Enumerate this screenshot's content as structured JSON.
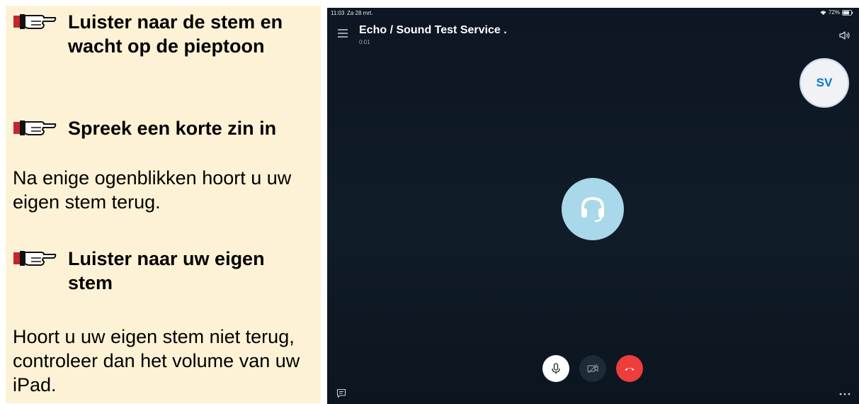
{
  "instructions": {
    "step1": "Luister naar de stem en wacht op de pieptoon",
    "step2": "Spreek een korte zin in",
    "para1": "Na enige ogenblikken hoort u uw eigen stem terug.",
    "step3": "Luister naar uw eigen stem",
    "para2": "Hoort u uw eigen stem niet terug, controleer dan het volume van uw iPad."
  },
  "status_bar": {
    "time": "11:03",
    "date": "Za 28 mrt.",
    "battery": "72%"
  },
  "call": {
    "title": "Echo / Sound Test Service .",
    "duration": "0:01",
    "participant_initials": "SV"
  },
  "icons": {
    "step_marker": "pointing-hand-icon",
    "menu": "hamburger-menu-icon",
    "speaker": "speaker-icon",
    "center": "headset-icon",
    "mic": "microphone-icon",
    "video": "video-off-icon",
    "hangup": "hang-up-icon",
    "chat": "chat-icon",
    "more": "more-icon"
  },
  "colors": {
    "panel_background": "#fdf2d5",
    "call_background": "#0f1a26",
    "avatar_text": "#0078d4",
    "headset_circle": "#a8d8ea",
    "hangup": "#ee3d3d"
  }
}
